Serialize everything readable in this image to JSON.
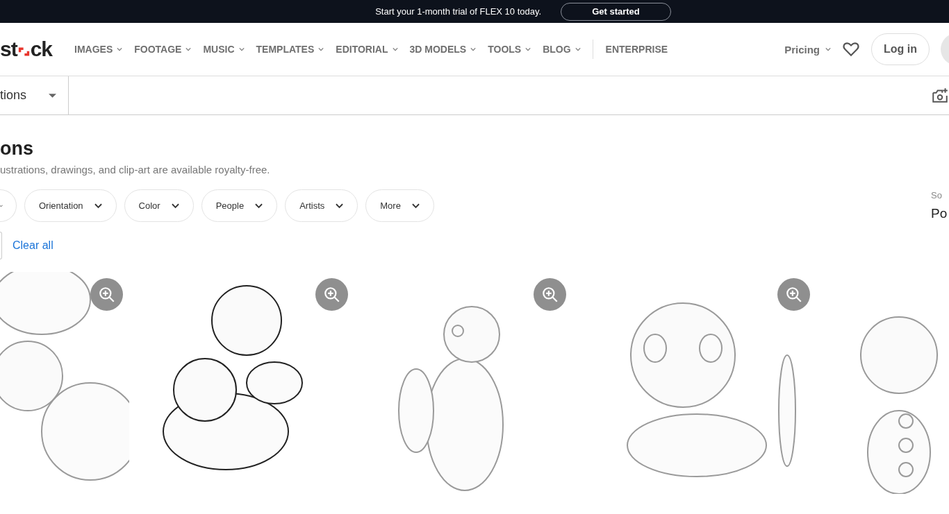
{
  "banner": {
    "text": "Start your 1-month trial of FLEX 10 today.",
    "button": "Get started"
  },
  "header": {
    "logo": {
      "left": "st",
      "right": "ck"
    },
    "nav": [
      {
        "label": "IMAGES",
        "dropdown": true
      },
      {
        "label": "FOOTAGE",
        "dropdown": true
      },
      {
        "label": "MUSIC",
        "dropdown": true
      },
      {
        "label": "TEMPLATES",
        "dropdown": true
      },
      {
        "label": "EDITORIAL",
        "dropdown": true
      },
      {
        "label": "3D MODELS",
        "dropdown": true
      },
      {
        "label": "TOOLS",
        "dropdown": true
      },
      {
        "label": "BLOG",
        "dropdown": true
      },
      {
        "label": "ENTERPRISE",
        "dropdown": false
      }
    ],
    "pricing": "Pricing",
    "login": "Log in"
  },
  "search": {
    "type": "tions"
  },
  "heading": "ons",
  "subtitle": "ustrations, drawings, and clip-art are available royalty-free.",
  "filters": [
    {
      "label": "Orientation"
    },
    {
      "label": "Color"
    },
    {
      "label": "People"
    },
    {
      "label": "Artists"
    },
    {
      "label": "More"
    }
  ],
  "clear_all": "Clear all",
  "sort": {
    "label": "So",
    "value": "Po"
  },
  "thumbnails": [
    {
      "kind": "picture",
      "zoom_button": true
    },
    {
      "kind": "picture",
      "zoom_button": true
    },
    {
      "kind": "picture",
      "zoom_button": true
    },
    {
      "kind": "picture",
      "zoom_button": true
    },
    {
      "kind": "picture",
      "zoom_button": false
    }
  ]
}
